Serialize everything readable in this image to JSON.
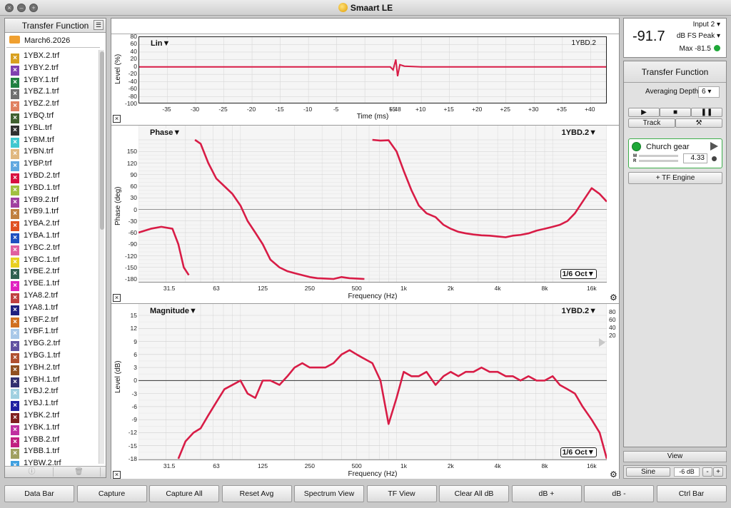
{
  "window": {
    "title": "Smaart LE"
  },
  "left_panel": {
    "title": "Transfer Function",
    "folder": "March6.2026",
    "files": [
      {
        "name": "1YBX.2.trf",
        "color": "#d8a020"
      },
      {
        "name": "1YBY.2.trf",
        "color": "#8040b0"
      },
      {
        "name": "1YBY.1.trf",
        "color": "#208040"
      },
      {
        "name": "1YBZ.1.trf",
        "color": "#707070"
      },
      {
        "name": "1YBZ.2.trf",
        "color": "#e08060"
      },
      {
        "name": "1YBQ.trf",
        "color": "#406030"
      },
      {
        "name": "1YBL.trf",
        "color": "#303030"
      },
      {
        "name": "1YBM.trf",
        "color": "#40c8d0"
      },
      {
        "name": "1YBN.trf",
        "color": "#e0b880"
      },
      {
        "name": "1YBP.trf",
        "color": "#60a8e0"
      },
      {
        "name": "1YBD.2.trf",
        "color": "#d81040"
      },
      {
        "name": "1YBD.1.trf",
        "color": "#a0c040"
      },
      {
        "name": "1YB9.2.trf",
        "color": "#a040a0"
      },
      {
        "name": "1YB9.1.trf",
        "color": "#c08040"
      },
      {
        "name": "1YBA.2.trf",
        "color": "#e05020"
      },
      {
        "name": "1YBA.1.trf",
        "color": "#2050c0"
      },
      {
        "name": "1YBC.2.trf",
        "color": "#e060a0"
      },
      {
        "name": "1YBC.1.trf",
        "color": "#e8d020"
      },
      {
        "name": "1YBE.2.trf",
        "color": "#306050"
      },
      {
        "name": "1YBE.1.trf",
        "color": "#e020c0"
      },
      {
        "name": "1YA8.2.trf",
        "color": "#c04040"
      },
      {
        "name": "1YA8.1.trf",
        "color": "#202080"
      },
      {
        "name": "1YBF.2.trf",
        "color": "#d07020"
      },
      {
        "name": "1YBF.1.trf",
        "color": "#a8c8e8"
      },
      {
        "name": "1YBG.2.trf",
        "color": "#6050a0"
      },
      {
        "name": "1YBG.1.trf",
        "color": "#b05030"
      },
      {
        "name": "1YBH.2.trf",
        "color": "#905020"
      },
      {
        "name": "1YBH.1.trf",
        "color": "#303070"
      },
      {
        "name": "1YBJ.2.trf",
        "color": "#a0d0e0"
      },
      {
        "name": "1YBJ.1.trf",
        "color": "#2020a0"
      },
      {
        "name": "1YBK.2.trf",
        "color": "#802020"
      },
      {
        "name": "1YBK.1.trf",
        "color": "#c030a0"
      },
      {
        "name": "1YBB.2.trf",
        "color": "#c02080"
      },
      {
        "name": "1YBB.1.trf",
        "color": "#a0a060"
      },
      {
        "name": "1YBW.2.trf",
        "color": "#40a0e0"
      }
    ],
    "footer_info_icon": "info-icon",
    "footer_trash_icon": "trash-icon"
  },
  "impulse_plot": {
    "title": "Lin▼",
    "tag": "1YBD.2",
    "ylabel": "Level (%)",
    "xlabel": "Time (ms)",
    "y_ticks": [
      "80",
      "60",
      "40",
      "20",
      "0",
      "-20",
      "-40",
      "-60",
      "-80",
      "-100"
    ],
    "x_ticks": [
      "-35",
      "-30",
      "-25",
      "-20",
      "-15",
      "-10",
      "-5",
      "5.48",
      "+5",
      "+10",
      "+15",
      "+20",
      "+25",
      "+30",
      "+35",
      "+40"
    ]
  },
  "phase_plot": {
    "title": "Phase▼",
    "tag": "1YBD.2▼",
    "ylabel": "Phase (deg)",
    "xlabel": "Frequency (Hz)",
    "smoothing": "1/6 Oct▼",
    "y_ticks": [
      "150",
      "120",
      "90",
      "60",
      "30",
      "0",
      "-30",
      "-60",
      "-90",
      "-120",
      "-150",
      "-180"
    ],
    "x_ticks": [
      "31.5",
      "63",
      "125",
      "250",
      "500",
      "1k",
      "2k",
      "4k",
      "8k",
      "16k"
    ]
  },
  "magnitude_plot": {
    "title": "Magnitude▼",
    "tag": "1YBD.2▼",
    "ylabel": "Level (dB)",
    "xlabel": "Frequency (Hz)",
    "smoothing": "1/6 Oct▼",
    "y_ticks": [
      "15",
      "12",
      "9",
      "6",
      "3",
      "0",
      "-3",
      "-6",
      "-9",
      "-12",
      "-15",
      "-18"
    ],
    "right_ticks": [
      "80",
      "60",
      "40",
      "20"
    ],
    "x_ticks": [
      "31.5",
      "63",
      "125",
      "250",
      "500",
      "1k",
      "2k",
      "4k",
      "8k",
      "16k"
    ]
  },
  "meter": {
    "value": "-91.7",
    "input": "Input 2",
    "unit": "dB FS Peak",
    "max": "Max -81.5"
  },
  "control": {
    "title": "Transfer Function",
    "averaging_label": "Averaging Depth:",
    "averaging_value": "6",
    "play_icon": "play-icon",
    "stop_icon": "stop-icon",
    "pause_icon": "pause-icon",
    "track_label": "Track",
    "tools_icon": "tools-icon",
    "engine_name": "Church gear",
    "meter_m": "M",
    "meter_r": "R",
    "delay_value": "4.33",
    "tf_engine_label": "+ TF Engine"
  },
  "view": {
    "label": "View",
    "generator": "Sine",
    "level": "-6 dB",
    "minus": "-",
    "plus": "+"
  },
  "bottom_bar": [
    "Data Bar",
    "Capture",
    "Capture All",
    "Reset Avg",
    "Spectrum View",
    "TF View",
    "Clear All dB",
    "dB +",
    "dB -",
    "Ctrl Bar"
  ],
  "colors": {
    "trace": "#d81c46",
    "signal_ok": "#1ea838"
  },
  "chart_data": [
    {
      "type": "line",
      "title": "Lin",
      "xlabel": "Time (ms)",
      "ylabel": "Level (%)",
      "ylim": [
        -100,
        80
      ],
      "xlim": [
        -40,
        43
      ],
      "series": [
        {
          "name": "1YBD.2",
          "x": [
            -40,
            4.5,
            5.0,
            5.48,
            5.8,
            6.2,
            7.0,
            10,
            43
          ],
          "y": [
            0,
            0,
            -8,
            20,
            -25,
            6,
            2,
            0,
            0
          ]
        }
      ]
    },
    {
      "type": "line",
      "title": "Phase",
      "xlabel": "Frequency (Hz)",
      "ylabel": "Phase (deg)",
      "ylim": [
        -180,
        180
      ],
      "x_scale": "log",
      "series": [
        {
          "name": "1YBD.2",
          "x": [
            20,
            24,
            28,
            33,
            36,
            39,
            42,
            46,
            50,
            56,
            63,
            71,
            80,
            90,
            100,
            112,
            125,
            140,
            160,
            180,
            200,
            224,
            250,
            280,
            315,
            355,
            400,
            450,
            500,
            560,
            630,
            710,
            800,
            900,
            1000,
            1120,
            1250,
            1400,
            1600,
            1800,
            2000,
            2240,
            2500,
            2800,
            3150,
            3550,
            4000,
            4500,
            5000,
            5600,
            6300,
            7100,
            8000,
            9000,
            10000,
            11200,
            12500,
            14000,
            16000,
            18000,
            20000
          ],
          "y": [
            -60,
            -50,
            -45,
            -50,
            -90,
            -150,
            -170,
            180,
            170,
            120,
            80,
            60,
            40,
            10,
            -30,
            -60,
            -90,
            -130,
            -150,
            -160,
            -165,
            -170,
            -175,
            -178,
            -179,
            -180,
            -175,
            -178,
            -179,
            -180,
            180,
            178,
            179,
            150,
            100,
            50,
            10,
            -10,
            -20,
            -40,
            -50,
            -58,
            -62,
            -65,
            -67,
            -68,
            -70,
            -72,
            -68,
            -66,
            -62,
            -55,
            -50,
            -45,
            -40,
            -30,
            -10,
            20,
            55,
            40,
            20
          ]
        }
      ]
    },
    {
      "type": "line",
      "title": "Magnitude",
      "xlabel": "Frequency (Hz)",
      "ylabel": "Level (dB)",
      "ylim": [
        -18,
        17
      ],
      "x_scale": "log",
      "series": [
        {
          "name": "1YBD.2",
          "x": [
            36,
            40,
            45,
            50,
            56,
            63,
            71,
            80,
            90,
            100,
            112,
            125,
            140,
            160,
            180,
            200,
            224,
            250,
            280,
            315,
            355,
            400,
            450,
            500,
            560,
            630,
            710,
            800,
            900,
            1000,
            1120,
            1250,
            1400,
            1600,
            1800,
            2000,
            2240,
            2500,
            2800,
            3150,
            3550,
            4000,
            4500,
            5000,
            5600,
            6300,
            7100,
            8000,
            9000,
            10000,
            11200,
            12500,
            14000,
            16000,
            18000,
            20000
          ],
          "y": [
            -18,
            -14,
            -12,
            -11,
            -8,
            -5,
            -2,
            -1,
            0,
            -3,
            -4,
            0,
            0,
            -1,
            1,
            3,
            4,
            3,
            3,
            3,
            4,
            6,
            7,
            6,
            5,
            4,
            0,
            -10,
            -4,
            2,
            1,
            1,
            2,
            -1,
            1,
            2,
            1,
            2,
            2,
            3,
            2,
            2,
            1,
            1,
            0,
            1,
            0,
            0,
            1,
            -1,
            -2,
            -3,
            -6,
            -9,
            -12,
            -18
          ]
        }
      ]
    }
  ]
}
